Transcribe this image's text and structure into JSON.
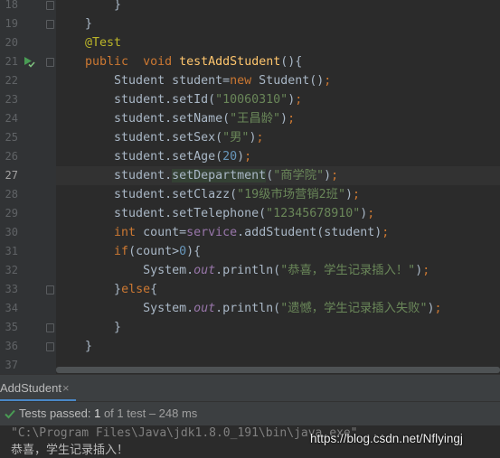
{
  "editor": {
    "active_line": 27,
    "lines": [
      {
        "n": "18",
        "tokens": [
          {
            "t": "        }",
            "c": ""
          }
        ]
      },
      {
        "n": "19",
        "tokens": [
          {
            "t": "    }",
            "c": ""
          }
        ]
      },
      {
        "n": "20",
        "tokens": [
          {
            "t": "    ",
            "c": ""
          },
          {
            "t": "@Test",
            "c": "ann"
          }
        ]
      },
      {
        "n": "21",
        "tokens": [
          {
            "t": "    ",
            "c": ""
          },
          {
            "t": "public",
            "c": "kw"
          },
          {
            "t": "  ",
            "c": ""
          },
          {
            "t": "void",
            "c": "kw"
          },
          {
            "t": " ",
            "c": ""
          },
          {
            "t": "testAddStudent",
            "c": "fn"
          },
          {
            "t": "(){",
            "c": ""
          }
        ]
      },
      {
        "n": "22",
        "tokens": [
          {
            "t": "        Student student=",
            "c": ""
          },
          {
            "t": "new",
            "c": "kw"
          },
          {
            "t": " Student()",
            "c": ""
          },
          {
            "t": ";",
            "c": "kw"
          }
        ]
      },
      {
        "n": "23",
        "tokens": [
          {
            "t": "        student.setId(",
            "c": ""
          },
          {
            "t": "\"10060310\"",
            "c": "str"
          },
          {
            "t": ")",
            "c": ""
          },
          {
            "t": ";",
            "c": "kw"
          }
        ]
      },
      {
        "n": "24",
        "tokens": [
          {
            "t": "        student.setName(",
            "c": ""
          },
          {
            "t": "\"王昌龄\"",
            "c": "str"
          },
          {
            "t": ")",
            "c": ""
          },
          {
            "t": ";",
            "c": "kw"
          }
        ]
      },
      {
        "n": "25",
        "tokens": [
          {
            "t": "        student.setSex(",
            "c": ""
          },
          {
            "t": "\"男\"",
            "c": "str"
          },
          {
            "t": ")",
            "c": ""
          },
          {
            "t": ";",
            "c": "kw"
          }
        ]
      },
      {
        "n": "26",
        "tokens": [
          {
            "t": "        student.setAge(",
            "c": ""
          },
          {
            "t": "20",
            "c": "num"
          },
          {
            "t": ")",
            "c": ""
          },
          {
            "t": ";",
            "c": "kw"
          }
        ]
      },
      {
        "n": "27",
        "tokens": [
          {
            "t": "        student.",
            "c": ""
          },
          {
            "t": "setD",
            "c": "hl"
          },
          {
            "t": "|",
            "c": "caret"
          },
          {
            "t": "epartment",
            "c": "hl"
          },
          {
            "t": "(",
            "c": ""
          },
          {
            "t": "\"商学院\"",
            "c": "str"
          },
          {
            "t": ")",
            "c": ""
          },
          {
            "t": ";",
            "c": "kw"
          }
        ]
      },
      {
        "n": "28",
        "tokens": [
          {
            "t": "        student.setClazz(",
            "c": ""
          },
          {
            "t": "\"19级市场营销2班\"",
            "c": "str"
          },
          {
            "t": ")",
            "c": ""
          },
          {
            "t": ";",
            "c": "kw"
          }
        ]
      },
      {
        "n": "29",
        "tokens": [
          {
            "t": "        student.setTelephone(",
            "c": ""
          },
          {
            "t": "\"12345678910\"",
            "c": "str"
          },
          {
            "t": ")",
            "c": ""
          },
          {
            "t": ";",
            "c": "kw"
          }
        ]
      },
      {
        "n": "30",
        "tokens": [
          {
            "t": "        ",
            "c": ""
          },
          {
            "t": "int",
            "c": "kw"
          },
          {
            "t": " count=",
            "c": ""
          },
          {
            "t": "service",
            "c": "fld"
          },
          {
            "t": ".addStudent(student)",
            "c": ""
          },
          {
            "t": ";",
            "c": "kw"
          }
        ]
      },
      {
        "n": "31",
        "tokens": [
          {
            "t": "        ",
            "c": ""
          },
          {
            "t": "if",
            "c": "kw"
          },
          {
            "t": "(count>",
            "c": ""
          },
          {
            "t": "0",
            "c": "num"
          },
          {
            "t": "){",
            "c": ""
          }
        ]
      },
      {
        "n": "32",
        "tokens": [
          {
            "t": "            System.",
            "c": ""
          },
          {
            "t": "out",
            "c": "sfld"
          },
          {
            "t": ".println(",
            "c": ""
          },
          {
            "t": "\"恭喜，学生记录插入！\"",
            "c": "str"
          },
          {
            "t": ")",
            "c": ""
          },
          {
            "t": ";",
            "c": "kw"
          }
        ]
      },
      {
        "n": "33",
        "tokens": [
          {
            "t": "        }",
            "c": ""
          },
          {
            "t": "else",
            "c": "kw"
          },
          {
            "t": "{",
            "c": ""
          }
        ]
      },
      {
        "n": "34",
        "tokens": [
          {
            "t": "            System.",
            "c": ""
          },
          {
            "t": "out",
            "c": "sfld"
          },
          {
            "t": ".println(",
            "c": ""
          },
          {
            "t": "\"遗憾，学生记录插入失败\"",
            "c": "str"
          },
          {
            "t": ")",
            "c": ""
          },
          {
            "t": ";",
            "c": "kw"
          }
        ]
      },
      {
        "n": "35",
        "tokens": [
          {
            "t": "        }",
            "c": ""
          }
        ]
      },
      {
        "n": "36",
        "tokens": [
          {
            "t": "    }",
            "c": ""
          }
        ]
      },
      {
        "n": "37",
        "tokens": [
          {
            "t": "",
            "c": ""
          }
        ]
      }
    ],
    "fold_lines": [
      "18",
      "19",
      "21",
      "33",
      "35",
      "36"
    ],
    "run_gutter_line": "21",
    "run_icon": "run-test-icon"
  },
  "run_tab": {
    "label": "AddStudent",
    "close_icon": "close-icon",
    "close_glyph": "×"
  },
  "status": {
    "icon": "check-icon",
    "prefix": "Tests passed: ",
    "passed": "1",
    "suffix": " of 1 test – 248 ms"
  },
  "console": {
    "command": "\"C:\\Program Files\\Java\\jdk1.8.0_191\\bin\\java.exe\" ...",
    "output": "恭喜，学生记录插入！"
  },
  "watermark": "https://blog.csdn.net/Nflyingj",
  "colors": {
    "background": "#2b2b2b",
    "gutter": "#313335",
    "keyword": "#cc7832",
    "string": "#6a8759",
    "number": "#6897bb",
    "annotation": "#bbb529",
    "method": "#ffc66d",
    "field": "#9876aa",
    "test_passed": "#499c54"
  }
}
